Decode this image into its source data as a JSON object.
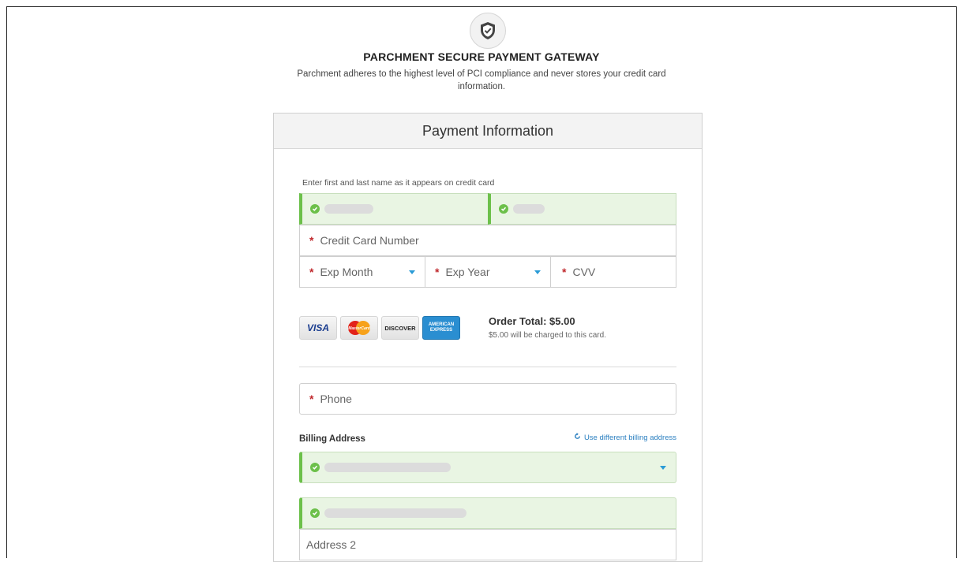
{
  "gateway": {
    "title": "PARCHMENT SECURE PAYMENT GATEWAY",
    "description": "Parchment adheres to the highest level of PCI compliance and never stores your credit card information."
  },
  "payment": {
    "heading": "Payment Information",
    "name_hint": "Enter first and last name as it appears on credit card",
    "card_number_placeholder": "Credit Card Number",
    "exp_month_placeholder": "Exp Month",
    "exp_year_placeholder": "Exp Year",
    "cvv_placeholder": "CVV",
    "required_mark": "*"
  },
  "card_logos": {
    "visa": "VISA",
    "mastercard": "MasterCard",
    "discover": "DISCOVER",
    "amex": "AMERICAN EXPRESS"
  },
  "order": {
    "total_label": "Order Total: $5.00",
    "charge_note": "$5.00 will be charged to this card."
  },
  "contact": {
    "phone_placeholder": "Phone"
  },
  "billing": {
    "label": "Billing Address",
    "different_link": "Use different billing address",
    "address2_placeholder": "Address 2"
  },
  "colors": {
    "valid_bg": "#e9f5e3",
    "valid_bar": "#6cc04a",
    "required": "#c0282c",
    "link": "#2a7fc0",
    "caret": "#2a9bd6"
  },
  "icons": [
    "shield-icon",
    "check-icon",
    "chevron-down-icon",
    "refresh-icon"
  ]
}
